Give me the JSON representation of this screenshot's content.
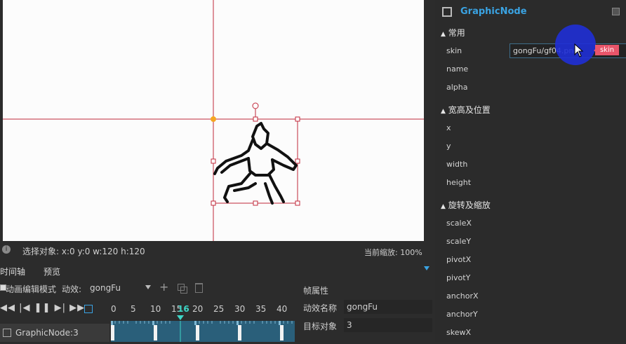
{
  "status": {
    "selected": "选择对象: x:0 y:0  w:120 h:120",
    "zoom": "当前缩放: 100%"
  },
  "tabs": [
    "时间轴",
    "预览"
  ],
  "anim": {
    "mode_label": "动画编辑模式",
    "effect_label": "动效:",
    "effect_value": "gongFu",
    "ticks": [
      "0",
      "5",
      "10",
      "15",
      "20",
      "25",
      "30",
      "35",
      "40"
    ],
    "current_frame": "16",
    "layer_name": "GraphicNode:3"
  },
  "frame_props": {
    "title": "帧属性",
    "name_label": "动效名称",
    "name_value": "gongFu",
    "target_label": "目标对象",
    "target_value": "3"
  },
  "panel": {
    "title": "GraphicNode",
    "sections": [
      {
        "title": "常用",
        "rows": [
          "skin",
          "name",
          "alpha"
        ]
      },
      {
        "title": "宽高及位置",
        "rows": [
          "x",
          "y",
          "width",
          "height"
        ]
      },
      {
        "title": "旋转及缩放",
        "rows": [
          "scaleX",
          "scaleY",
          "pivotX",
          "pivotY",
          "anchorX",
          "anchorY",
          "skewX"
        ]
      }
    ],
    "skin_value": "gongFu/gf04.png",
    "skin_tag": "skin"
  },
  "colors": {
    "accent": "#3aa3e3",
    "tag": "#e8556a",
    "cursor_circle": "#1f2fd6",
    "guide": "#c0283a"
  }
}
